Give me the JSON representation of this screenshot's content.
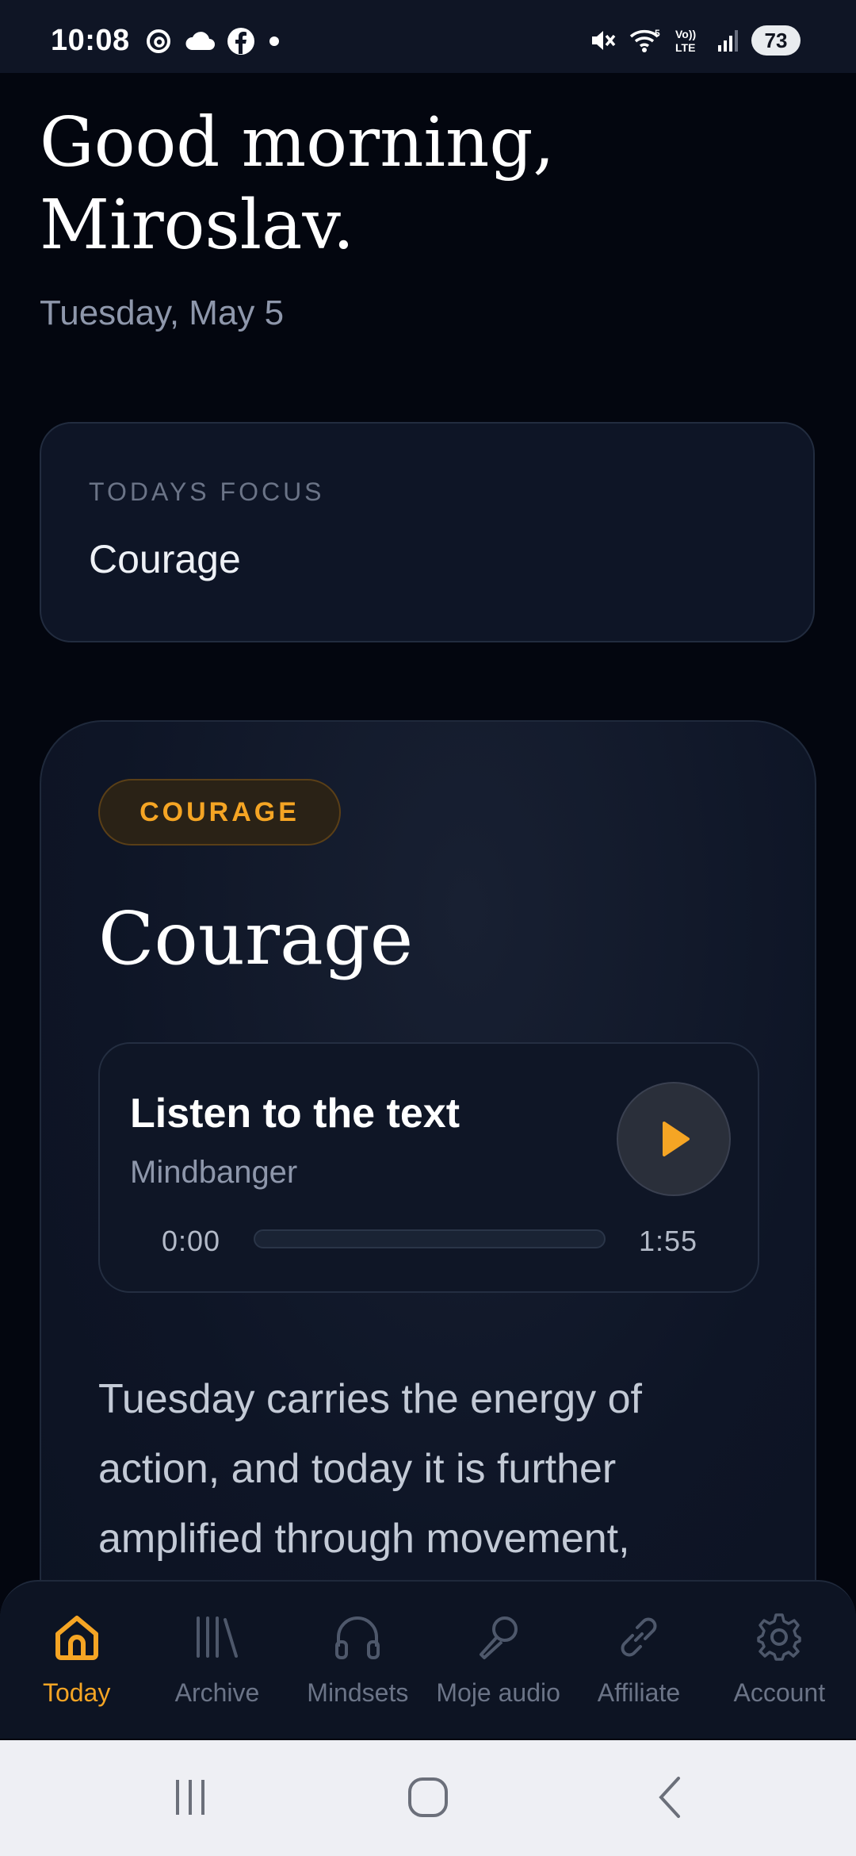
{
  "status_bar": {
    "time": "10:08",
    "left_icons": [
      "threads-icon",
      "cloud-icon",
      "facebook-icon",
      "dot-icon"
    ],
    "right_icons": [
      "mute-icon",
      "wifi-icon",
      "volte-icon",
      "signal-icon"
    ],
    "battery": "73"
  },
  "greeting": {
    "line1": "Good morning,",
    "line2": "Miroslav.",
    "date": "Tuesday, May 5"
  },
  "focus": {
    "label": "TODAYS FOCUS",
    "value": "Courage"
  },
  "card": {
    "tag": "COURAGE",
    "title": "Courage",
    "player": {
      "title": "Listen to the text",
      "subtitle": "Mindbanger",
      "current_time": "0:00",
      "duration": "1:55",
      "progress": 0
    },
    "body": "Tuesday carries the energy of action, and today it is further amplified through movement,"
  },
  "nav": {
    "items": [
      {
        "label": "Today",
        "icon": "home-icon",
        "active": true
      },
      {
        "label": "Archive",
        "icon": "library-icon",
        "active": false
      },
      {
        "label": "Mindsets",
        "icon": "headphones-icon",
        "active": false
      },
      {
        "label": "Moje audio",
        "icon": "microphone-icon",
        "active": false
      },
      {
        "label": "Affiliate",
        "icon": "link-icon",
        "active": false
      },
      {
        "label": "Account",
        "icon": "gear-icon",
        "active": false
      }
    ]
  },
  "colors": {
    "accent": "#f5a524",
    "background": "#03060f",
    "card": "#0e1526",
    "muted_text": "#8e97ab"
  }
}
